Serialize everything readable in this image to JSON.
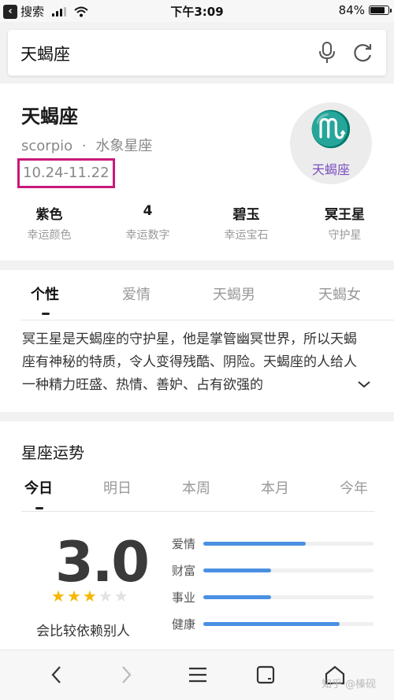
{
  "status_bar": {
    "back_label": "搜索",
    "time": "下午3:09",
    "battery": "84%",
    "battery_level": 0.84
  },
  "search": {
    "query": "天蝎座"
  },
  "sign": {
    "name": "天蝎座",
    "english": "scorpio",
    "separator": "·",
    "element": "水象星座",
    "date_range": "10.24-11.22",
    "logo_symbol": "♏",
    "logo_label": "天蝎座",
    "accent_color": "#7a4fc0",
    "highlight_color": "#c8197a",
    "attributes": [
      {
        "value": "紫色",
        "label": "幸运颜色"
      },
      {
        "value": "4",
        "label": "幸运数字"
      },
      {
        "value": "碧玉",
        "label": "幸运宝石"
      },
      {
        "value": "冥王星",
        "label": "守护星"
      }
    ]
  },
  "personality": {
    "tabs": [
      "个性",
      "爱情",
      "天蝎男",
      "天蝎女"
    ],
    "active_tab": 0,
    "description": "冥王星是天蝎座的守护星，他是掌管幽冥世界，所以天蝎座有神秘的特质，令人变得残酷、阴险。天蝎座的人给人一种精力旺盛、热情、善妒、占有欲强的"
  },
  "fortune": {
    "title": "星座运势",
    "tabs": [
      "今日",
      "明日",
      "本周",
      "本月",
      "今年"
    ],
    "active_tab": 0,
    "score": "3.0",
    "stars_filled": 3,
    "stars_total": 5,
    "note": "会比较依赖别人",
    "bar_color": "#4a90e2",
    "bars": [
      {
        "label": "爱情",
        "level": 0.6
      },
      {
        "label": "财富",
        "level": 0.4
      },
      {
        "label": "事业",
        "level": 0.4
      },
      {
        "label": "健康",
        "level": 0.8
      }
    ]
  },
  "toolbar": {
    "items": [
      "back-icon",
      "forward-icon",
      "menu-icon",
      "tabs-icon",
      "home-icon"
    ],
    "watermark": "知乎 @榛砚"
  }
}
